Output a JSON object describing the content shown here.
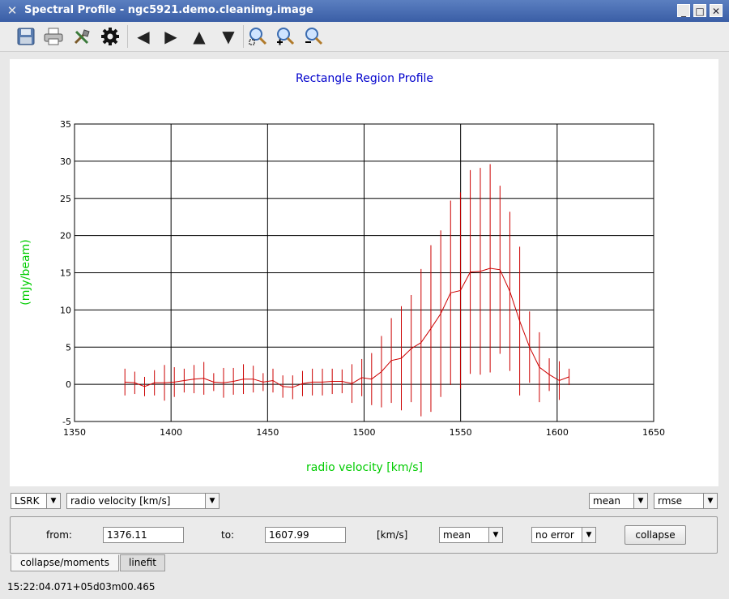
{
  "window": {
    "title": "Spectral Profile - ngc5921.demo.cleanimg.image",
    "app_icon": "x-icon",
    "buttons": {
      "minimize": "_",
      "maximize": "□",
      "close": "✕"
    }
  },
  "toolbar": {
    "items": [
      "save-icon",
      "print-icon",
      "preferences-icon",
      "gear-icon",
      "arrow-left-icon",
      "arrow-right-icon",
      "arrow-up-icon",
      "arrow-down-icon",
      "zoom-region-icon",
      "zoom-in-icon",
      "zoom-out-icon"
    ]
  },
  "chart_data": {
    "type": "line",
    "title": "Rectangle Region Profile",
    "xlabel": "radio velocity [km/s]",
    "ylabel": "(mJy/beam)",
    "xlim": [
      1350,
      1650
    ],
    "ylim": [
      -5,
      35
    ],
    "xticks": [
      "1350",
      "1400",
      "1450",
      "1500",
      "1550",
      "1600",
      "1650"
    ],
    "yticks": [
      "-5",
      "0",
      "5",
      "10",
      "15",
      "20",
      "25",
      "30",
      "35"
    ],
    "grid": true,
    "colors": {
      "title": "#0000cc",
      "axis_labels": "#00cc00",
      "series": "#cc0000"
    },
    "series": [
      {
        "x": [
          1376.1,
          1381.2,
          1386.3,
          1391.4,
          1396.6,
          1401.7,
          1406.8,
          1411.9,
          1417.0,
          1422.1,
          1427.2,
          1432.3,
          1437.5,
          1442.6,
          1447.7,
          1452.8,
          1457.9,
          1463.0,
          1468.1,
          1473.2,
          1478.4,
          1483.5,
          1488.6,
          1493.7,
          1498.8,
          1503.9,
          1509.0,
          1514.1,
          1519.3,
          1524.4,
          1529.5,
          1534.6,
          1539.7,
          1544.8,
          1549.9,
          1555.0,
          1560.2,
          1565.3,
          1570.4,
          1575.5,
          1580.6,
          1585.7,
          1590.8,
          1595.9,
          1601.1,
          1606.2
        ],
        "y": [
          0.3,
          0.2,
          -0.3,
          0.2,
          0.2,
          0.3,
          0.5,
          0.7,
          0.8,
          0.3,
          0.2,
          0.4,
          0.7,
          0.7,
          0.3,
          0.5,
          -0.3,
          -0.4,
          0.1,
          0.3,
          0.3,
          0.4,
          0.4,
          0.1,
          0.9,
          0.7,
          1.7,
          3.2,
          3.5,
          4.8,
          5.6,
          7.5,
          9.5,
          12.3,
          12.6,
          15.1,
          15.2,
          15.6,
          15.4,
          12.5,
          8.5,
          5.0,
          2.3,
          1.3,
          0.5,
          1.0
        ],
        "err": [
          1.8,
          1.5,
          1.3,
          1.7,
          2.4,
          2.0,
          1.6,
          1.9,
          2.2,
          1.2,
          2.0,
          1.8,
          2.0,
          1.8,
          1.2,
          1.6,
          1.5,
          1.6,
          1.7,
          1.8,
          1.8,
          1.7,
          1.6,
          2.6,
          2.5,
          3.5,
          4.8,
          5.7,
          7.0,
          7.2,
          9.9,
          11.2,
          11.2,
          12.4,
          13.2,
          13.7,
          13.9,
          14.0,
          11.3,
          10.7,
          10.0,
          4.8,
          4.7,
          2.2,
          2.6,
          1.1
        ]
      }
    ]
  },
  "controls": {
    "frame": "LSRK",
    "units": "radio velocity [km/s]",
    "stat": "mean",
    "error": "rmse"
  },
  "collapse_panel": {
    "from_label": "from:",
    "from_value": "1376.11",
    "to_label": "to:",
    "to_value": "1607.99",
    "units_label": "[km/s]",
    "method": "mean",
    "error": "no error",
    "collapse_button": "collapse"
  },
  "tabs": [
    "collapse/moments",
    "linefit"
  ],
  "status": "15:22:04.071+05d03m00.465"
}
